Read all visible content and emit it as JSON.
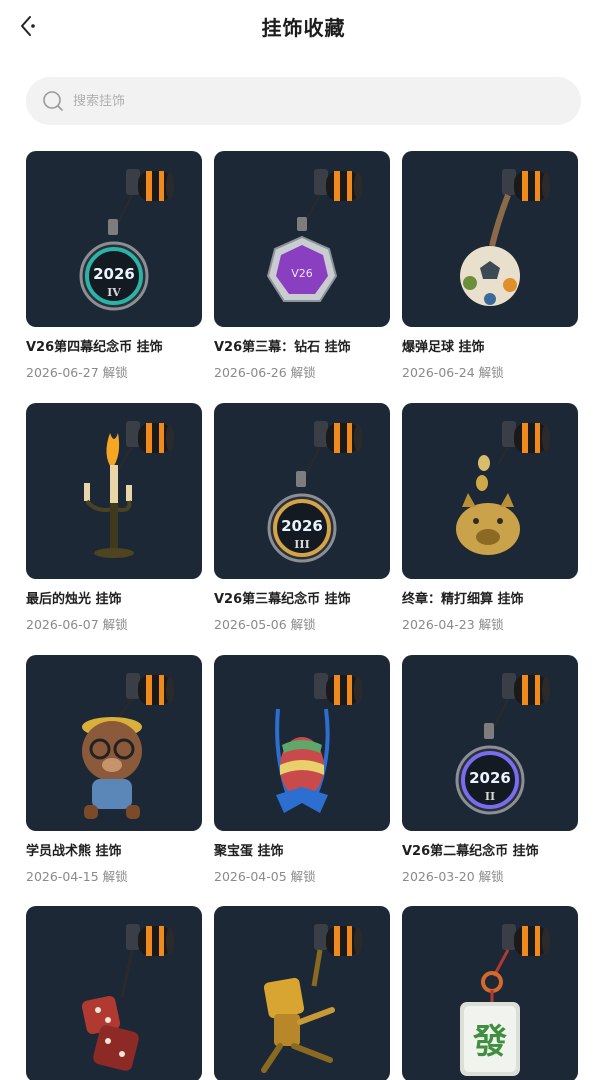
{
  "header": {
    "title": "挂饰收藏"
  },
  "search": {
    "placeholder": "搜索挂饰"
  },
  "items": [
    {
      "name": "V26第四幕纪念币 挂饰",
      "date": "2026-06-27 解锁",
      "icon": "medal-2026-iv-icon",
      "accent": "#2bb3a8",
      "label": "2026",
      "sub": "IV"
    },
    {
      "name": "V26第三幕：钻石 挂饰",
      "date": "2026-06-26 解锁",
      "icon": "diamond-badge-icon",
      "accent": "#8a3fc0",
      "label": "V26"
    },
    {
      "name": "爆弹足球 挂饰",
      "date": "2026-06-24 解锁",
      "icon": "soccer-ball-icon",
      "accent": "#e8e0cc"
    },
    {
      "name": "最后的烛光 挂饰",
      "date": "2026-06-07 解锁",
      "icon": "candelabra-icon",
      "accent": "#f5a623"
    },
    {
      "name": "V26第三幕纪念币 挂饰",
      "date": "2026-05-06 解锁",
      "icon": "medal-2026-iii-icon",
      "accent": "#d4a446",
      "label": "2026",
      "sub": "III"
    },
    {
      "name": "终章：精打细算 挂饰",
      "date": "2026-04-23 解锁",
      "icon": "piggy-bank-icon",
      "accent": "#c9a24a"
    },
    {
      "name": "学员战术熊 挂饰",
      "date": "2026-04-15 解锁",
      "icon": "teddy-bear-icon",
      "accent": "#8a5a3a"
    },
    {
      "name": "聚宝蛋 挂饰",
      "date": "2026-04-05 解锁",
      "icon": "easter-egg-icon",
      "accent": "#2d6fd0"
    },
    {
      "name": "V26第二幕纪念币 挂饰",
      "date": "2026-03-20 解锁",
      "icon": "medal-2026-ii-icon",
      "accent": "#7a6cf0",
      "label": "2026",
      "sub": "II"
    },
    {
      "name": "",
      "date": "",
      "icon": "dice-icon",
      "accent": "#b03a32"
    },
    {
      "name": "",
      "date": "",
      "icon": "golden-robot-icon",
      "accent": "#d8a630"
    },
    {
      "name": "",
      "date": "",
      "icon": "mahjong-tile-icon",
      "accent": "#3f8f3f",
      "label": "發"
    }
  ]
}
